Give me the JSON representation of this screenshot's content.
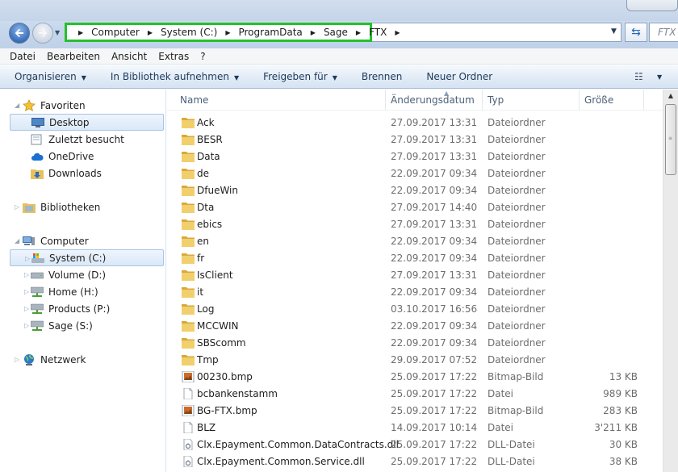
{
  "address": {
    "crumbs": [
      "Computer",
      "System (C:)",
      "ProgramData",
      "Sage",
      "FTX"
    ],
    "search_placeholder": "FTX d"
  },
  "menubar": [
    "Datei",
    "Bearbeiten",
    "Ansicht",
    "Extras",
    "?"
  ],
  "commandbar": {
    "organize": "Organisieren",
    "include_library": "In Bibliothek aufnehmen",
    "share": "Freigeben für",
    "burn": "Brennen",
    "new_folder": "Neuer Ordner"
  },
  "navpane": {
    "favorites": {
      "label": "Favoriten",
      "items": [
        "Desktop",
        "Zuletzt besucht",
        "OneDrive",
        "Downloads"
      ]
    },
    "libraries": "Bibliotheken",
    "computer": {
      "label": "Computer",
      "items": [
        "System (C:)",
        "Volume (D:)",
        "Home (H:)",
        "Products (P:)",
        "Sage (S:)"
      ]
    },
    "network": "Netzwerk"
  },
  "columns": {
    "name": "Name",
    "date": "Änderungsdatum",
    "type": "Typ",
    "size": "Größe"
  },
  "files": [
    {
      "name": "Ack",
      "date": "27.09.2017 13:31",
      "type": "Dateiordner",
      "size": "",
      "icon": "folder"
    },
    {
      "name": "BESR",
      "date": "27.09.2017 13:31",
      "type": "Dateiordner",
      "size": "",
      "icon": "folder"
    },
    {
      "name": "Data",
      "date": "27.09.2017 13:31",
      "type": "Dateiordner",
      "size": "",
      "icon": "folder"
    },
    {
      "name": "de",
      "date": "22.09.2017 09:34",
      "type": "Dateiordner",
      "size": "",
      "icon": "folder"
    },
    {
      "name": "DfueWin",
      "date": "22.09.2017 09:34",
      "type": "Dateiordner",
      "size": "",
      "icon": "folder"
    },
    {
      "name": "Dta",
      "date": "27.09.2017 14:40",
      "type": "Dateiordner",
      "size": "",
      "icon": "folder"
    },
    {
      "name": "ebics",
      "date": "27.09.2017 13:31",
      "type": "Dateiordner",
      "size": "",
      "icon": "folder"
    },
    {
      "name": "en",
      "date": "22.09.2017 09:34",
      "type": "Dateiordner",
      "size": "",
      "icon": "folder"
    },
    {
      "name": "fr",
      "date": "22.09.2017 09:34",
      "type": "Dateiordner",
      "size": "",
      "icon": "folder"
    },
    {
      "name": "IsClient",
      "date": "27.09.2017 13:31",
      "type": "Dateiordner",
      "size": "",
      "icon": "folder"
    },
    {
      "name": "it",
      "date": "22.09.2017 09:34",
      "type": "Dateiordner",
      "size": "",
      "icon": "folder"
    },
    {
      "name": "Log",
      "date": "03.10.2017 16:56",
      "type": "Dateiordner",
      "size": "",
      "icon": "folder"
    },
    {
      "name": "MCCWIN",
      "date": "22.09.2017 09:34",
      "type": "Dateiordner",
      "size": "",
      "icon": "folder"
    },
    {
      "name": "SBScomm",
      "date": "22.09.2017 09:34",
      "type": "Dateiordner",
      "size": "",
      "icon": "folder"
    },
    {
      "name": "Tmp",
      "date": "29.09.2017 07:52",
      "type": "Dateiordner",
      "size": "",
      "icon": "folder"
    },
    {
      "name": "00230.bmp",
      "date": "25.09.2017 17:22",
      "type": "Bitmap-Bild",
      "size": "13 KB",
      "icon": "bitmap"
    },
    {
      "name": "bcbankenstamm",
      "date": "25.09.2017 17:22",
      "type": "Datei",
      "size": "989 KB",
      "icon": "file"
    },
    {
      "name": "BG-FTX.bmp",
      "date": "25.09.2017 17:22",
      "type": "Bitmap-Bild",
      "size": "283 KB",
      "icon": "bitmap"
    },
    {
      "name": "BLZ",
      "date": "14.09.2017 10:14",
      "type": "Datei",
      "size": "3'211 KB",
      "icon": "file"
    },
    {
      "name": "Clx.Epayment.Common.DataContracts.dll",
      "date": "25.09.2017 17:22",
      "type": "DLL-Datei",
      "size": "30 KB",
      "icon": "dll"
    },
    {
      "name": "Clx.Epayment.Common.Service.dll",
      "date": "25.09.2017 17:22",
      "type": "DLL-Datei",
      "size": "38 KB",
      "icon": "dll"
    }
  ],
  "colors": {
    "highlight_border": "#23c12c",
    "folder": "#e8c15a"
  }
}
